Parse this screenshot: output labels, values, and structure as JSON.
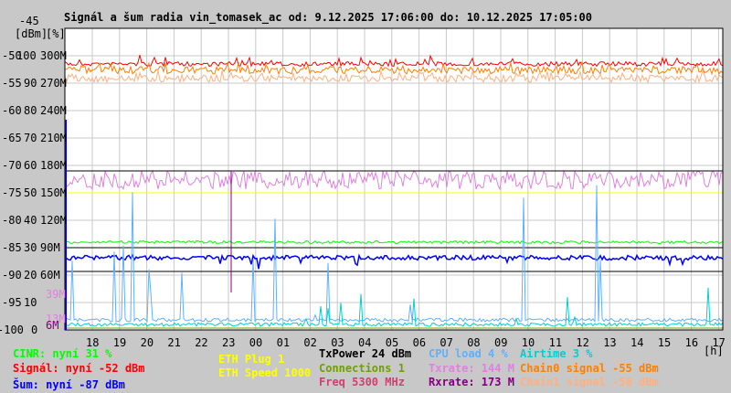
{
  "chart_data": {
    "type": "line",
    "title": "Signál a šum radia vin_tomasek_ac od: 9.12.2025 17:06:00 do: 10.12.2025 17:05:00",
    "y_units": [
      "[dBm]",
      "[%]"
    ],
    "y_dbm_ticks": [
      "-45",
      "-50",
      "-55",
      "-60",
      "-65",
      "-70",
      "-75",
      "-80",
      "-85",
      "-90",
      "-95",
      "-100"
    ],
    "y_pct_ticks": [
      "100",
      "90",
      "80",
      "70",
      "60",
      "50",
      "40",
      "30",
      "20",
      "10",
      "0"
    ],
    "y_rate_ticks": [
      "300M",
      "270M",
      "240M",
      "210M",
      "180M",
      "150M",
      "120M",
      "90M",
      "60M"
    ],
    "y_extra_ticks": [
      {
        "label": "39M",
        "color": "#e080e0"
      },
      {
        "label": "13M",
        "color": "#e080e0"
      },
      {
        "label": "6M",
        "color": "#800080"
      }
    ],
    "x_ticks": [
      "18",
      "19",
      "20",
      "21",
      "22",
      "23",
      "00",
      "01",
      "02",
      "03",
      "04",
      "05",
      "06",
      "07",
      "08",
      "09",
      "10",
      "11",
      "12",
      "13",
      "14",
      "15",
      "16",
      "17"
    ],
    "x_unit": "[h]",
    "ylim": [
      -100,
      -45
    ],
    "grid": true,
    "series": [
      {
        "name": "Signál",
        "color": "#ff0000",
        "approx_dbm": -51.5
      },
      {
        "name": "Chain0 signal",
        "color": "#ff8000",
        "approx_dbm": -54
      },
      {
        "name": "Chain1 signal",
        "color": "#ffb080",
        "approx_dbm": -55
      },
      {
        "name": "Txrate",
        "color": "#e080e0",
        "approx_rate_M": 150
      },
      {
        "name": "ETH Speed",
        "color": "#ffff00",
        "approx_rate_M": 150
      },
      {
        "name": "CINR",
        "color": "#00ff00",
        "approx_pct": 31
      },
      {
        "name": "Šum",
        "color": "#0000ff",
        "approx_dbm": -87
      },
      {
        "name": "CPU load",
        "color": "#60b0ff",
        "approx_pct": 2
      },
      {
        "name": "Airtime",
        "color": "#00d0d0",
        "approx_pct": 1
      }
    ]
  },
  "legend": {
    "cinr": "CINR: nyní 31 %",
    "signal": "Signál: nyní -52 dBm",
    "noise": "Šum: nyní -87 dBm",
    "eth_plug": "ETH Plug 1",
    "eth_speed": "ETH Speed 1000",
    "txpower": "TxPower 24 dBm",
    "connections": "Connections 1",
    "freq": "Freq 5300 MHz",
    "cpu": "CPU load 4 %",
    "txrate": "Txrate: 144 M",
    "rxrate": "Rxrate: 173 M",
    "airtime": "Airtime 3 %",
    "chain0": "Chain0 signal -55 dBm",
    "chain1": "Chain1 signal -56 dBm"
  }
}
